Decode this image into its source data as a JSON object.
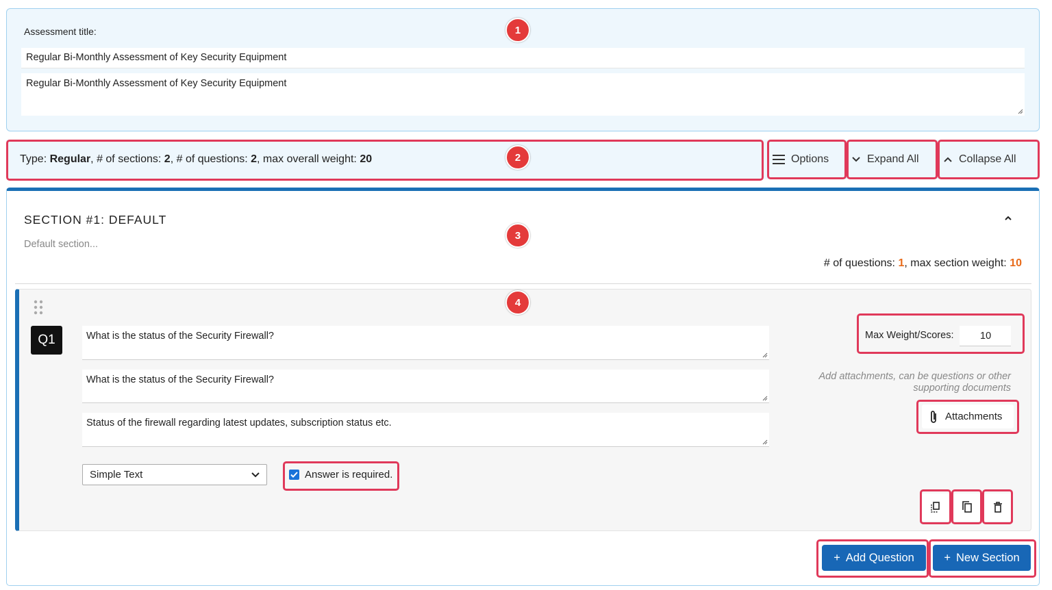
{
  "assessment": {
    "title_label": "Assessment title:",
    "title_value": "Regular Bi-Monthly Assessment of Key Security Equipment",
    "description_value": "Regular Bi-Monthly Assessment of Key Security Equipment"
  },
  "summary": {
    "type_label": "Type:",
    "type_value": "Regular",
    "sections_label": "# of sections:",
    "sections_value": "2",
    "questions_label": "# of questions:",
    "questions_value": "2",
    "weight_label": "max overall weight:",
    "weight_value": "20"
  },
  "toolbar": {
    "options_label": "Options",
    "expand_label": "Expand All",
    "collapse_label": "Collapse All"
  },
  "section": {
    "title": "SECTION #1: DEFAULT",
    "description": "Default section...",
    "questions_label": "# of questions:",
    "questions_value": "1",
    "weight_label": "max section weight:",
    "weight_value": "10"
  },
  "question": {
    "number": "Q1",
    "title_value": "What is the status of the Security Firewall?",
    "subtitle_value": "What is the status of the Security Firewall?",
    "description_value": "Status of the firewall regarding latest updates, subscription status etc.",
    "answer_type": "Simple Text",
    "required_label": "Answer is required.",
    "required_checked": true,
    "max_weight_label": "Max Weight/Scores:",
    "max_weight_value": "10",
    "attachments_hint": "Add attachments, can be questions or other supporting documents",
    "attachments_label": "Attachments"
  },
  "actions": {
    "add_question_label": "Add Question",
    "new_section_label": "New Section"
  },
  "markers": [
    "1",
    "2",
    "3",
    "4"
  ],
  "colors": {
    "accent": "#1867b6",
    "highlight": "#e0395a",
    "marker": "#e43a3a",
    "weight_value": "#e86b1a",
    "panel_bg": "#eef7fd"
  }
}
